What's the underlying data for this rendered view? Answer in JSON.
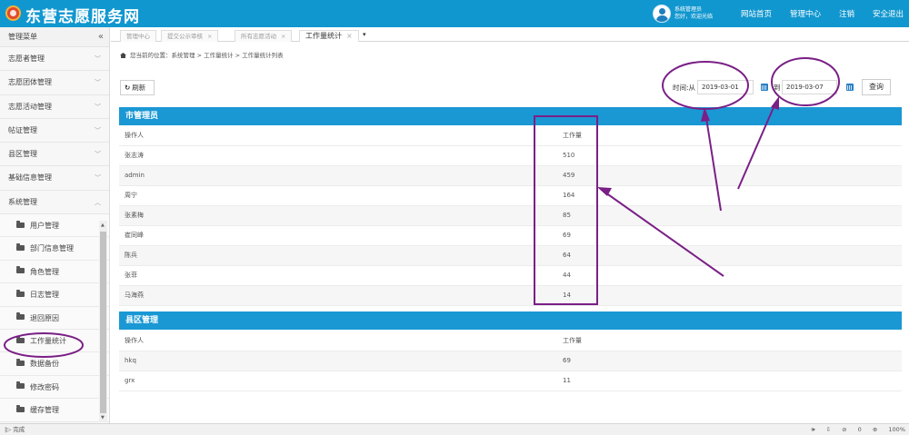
{
  "header": {
    "title": "东营志愿服务网",
    "user_line1": "系统管理员",
    "user_line2": "您好，欢迎光临",
    "nav": [
      "网站首页",
      "管理中心",
      "注销",
      "安全退出"
    ]
  },
  "sidebar": {
    "title": "管理菜单",
    "collapse": "«",
    "menus": [
      "志愿者管理",
      "志愿团体管理",
      "志愿活动管理",
      "帖证管理",
      "县区管理",
      "基础信息管理",
      "系统管理"
    ],
    "sub_items": [
      "用户管理",
      "部门信息管理",
      "角色管理",
      "日志管理",
      "退回原因",
      "工作量统计",
      "数据备份",
      "修改密码",
      "缓存管理"
    ]
  },
  "tabs": [
    {
      "label": "管理中心",
      "closable": false
    },
    {
      "label": "提交公示审核",
      "closable": true
    },
    {
      "label": "所有志愿活动",
      "closable": true
    },
    {
      "label": "工作量统计",
      "closable": true,
      "active": true
    }
  ],
  "breadcrumb": "您当前的位置：系统管理 > 工作量统计 > 工作量统计列表",
  "toolbar": {
    "refresh_label": "刷新",
    "time_from_label": "时间:从",
    "date_from": "2019-03-01",
    "to_label": "到",
    "date_to": "2019-03-07",
    "query_label": "查询"
  },
  "tables": [
    {
      "title": "市管理员",
      "col1": "操作人",
      "col2": "工作量",
      "rows": [
        {
          "name": "张志涛",
          "count": "510"
        },
        {
          "name": "admin",
          "count": "459"
        },
        {
          "name": "周宁",
          "count": "164"
        },
        {
          "name": "张素梅",
          "count": "85"
        },
        {
          "name": "崔同峰",
          "count": "69"
        },
        {
          "name": "陈兵",
          "count": "64"
        },
        {
          "name": "张菲",
          "count": "44"
        },
        {
          "name": "马海燕",
          "count": "14"
        }
      ]
    },
    {
      "title": "县区管理",
      "col1": "操作人",
      "col2": "工作量",
      "rows": [
        {
          "name": "hkq",
          "count": "69"
        },
        {
          "name": "grx",
          "count": "11"
        }
      ]
    }
  ],
  "statusbar": {
    "status": "完成",
    "zoom": "100%",
    "count": "0"
  },
  "colors": {
    "brand": "#1197cf",
    "panel_header": "#1a98d4",
    "annotation": "#7a1f86"
  }
}
